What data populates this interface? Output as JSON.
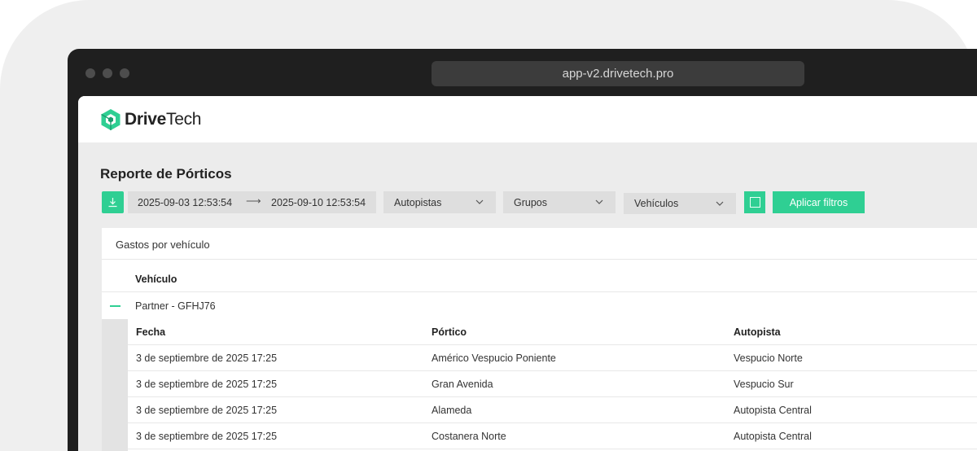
{
  "browser": {
    "url": "app-v2.drivetech.pro"
  },
  "app": {
    "logo": {
      "bold": "Drive",
      "regular": "Tech"
    },
    "page_title": "Reporte de Pórticos",
    "filters": {
      "date_from": "2025-09-03 12:53:54",
      "date_to": "2025-09-10 12:53:54",
      "autopistas": "Autopistas",
      "grupos": "Grupos",
      "vehiculos": "Vehículos",
      "apply_label": "Aplicar filtros"
    },
    "card": {
      "title": "Gastos por vehículo",
      "vehicle_header": "Vehículo",
      "vehicle_name": "Partner - GFHJ76",
      "sub_headers": [
        "Fecha",
        "Pórtico",
        "Autopista"
      ],
      "rows": [
        [
          "3 de septiembre de 2025 17:25",
          "Américo Vespucio Poniente",
          "Vespucio Norte"
        ],
        [
          "3 de septiembre de 2025 17:25",
          "Gran Avenida",
          "Vespucio Sur"
        ],
        [
          "3 de septiembre de 2025 17:25",
          "Alameda",
          "Autopista Central"
        ],
        [
          "3 de septiembre de 2025 17:25",
          "Costanera Norte",
          "Autopista Central"
        ]
      ]
    }
  },
  "colors": {
    "accent": "#2fcf93",
    "chrome": "#1f1f1f"
  }
}
